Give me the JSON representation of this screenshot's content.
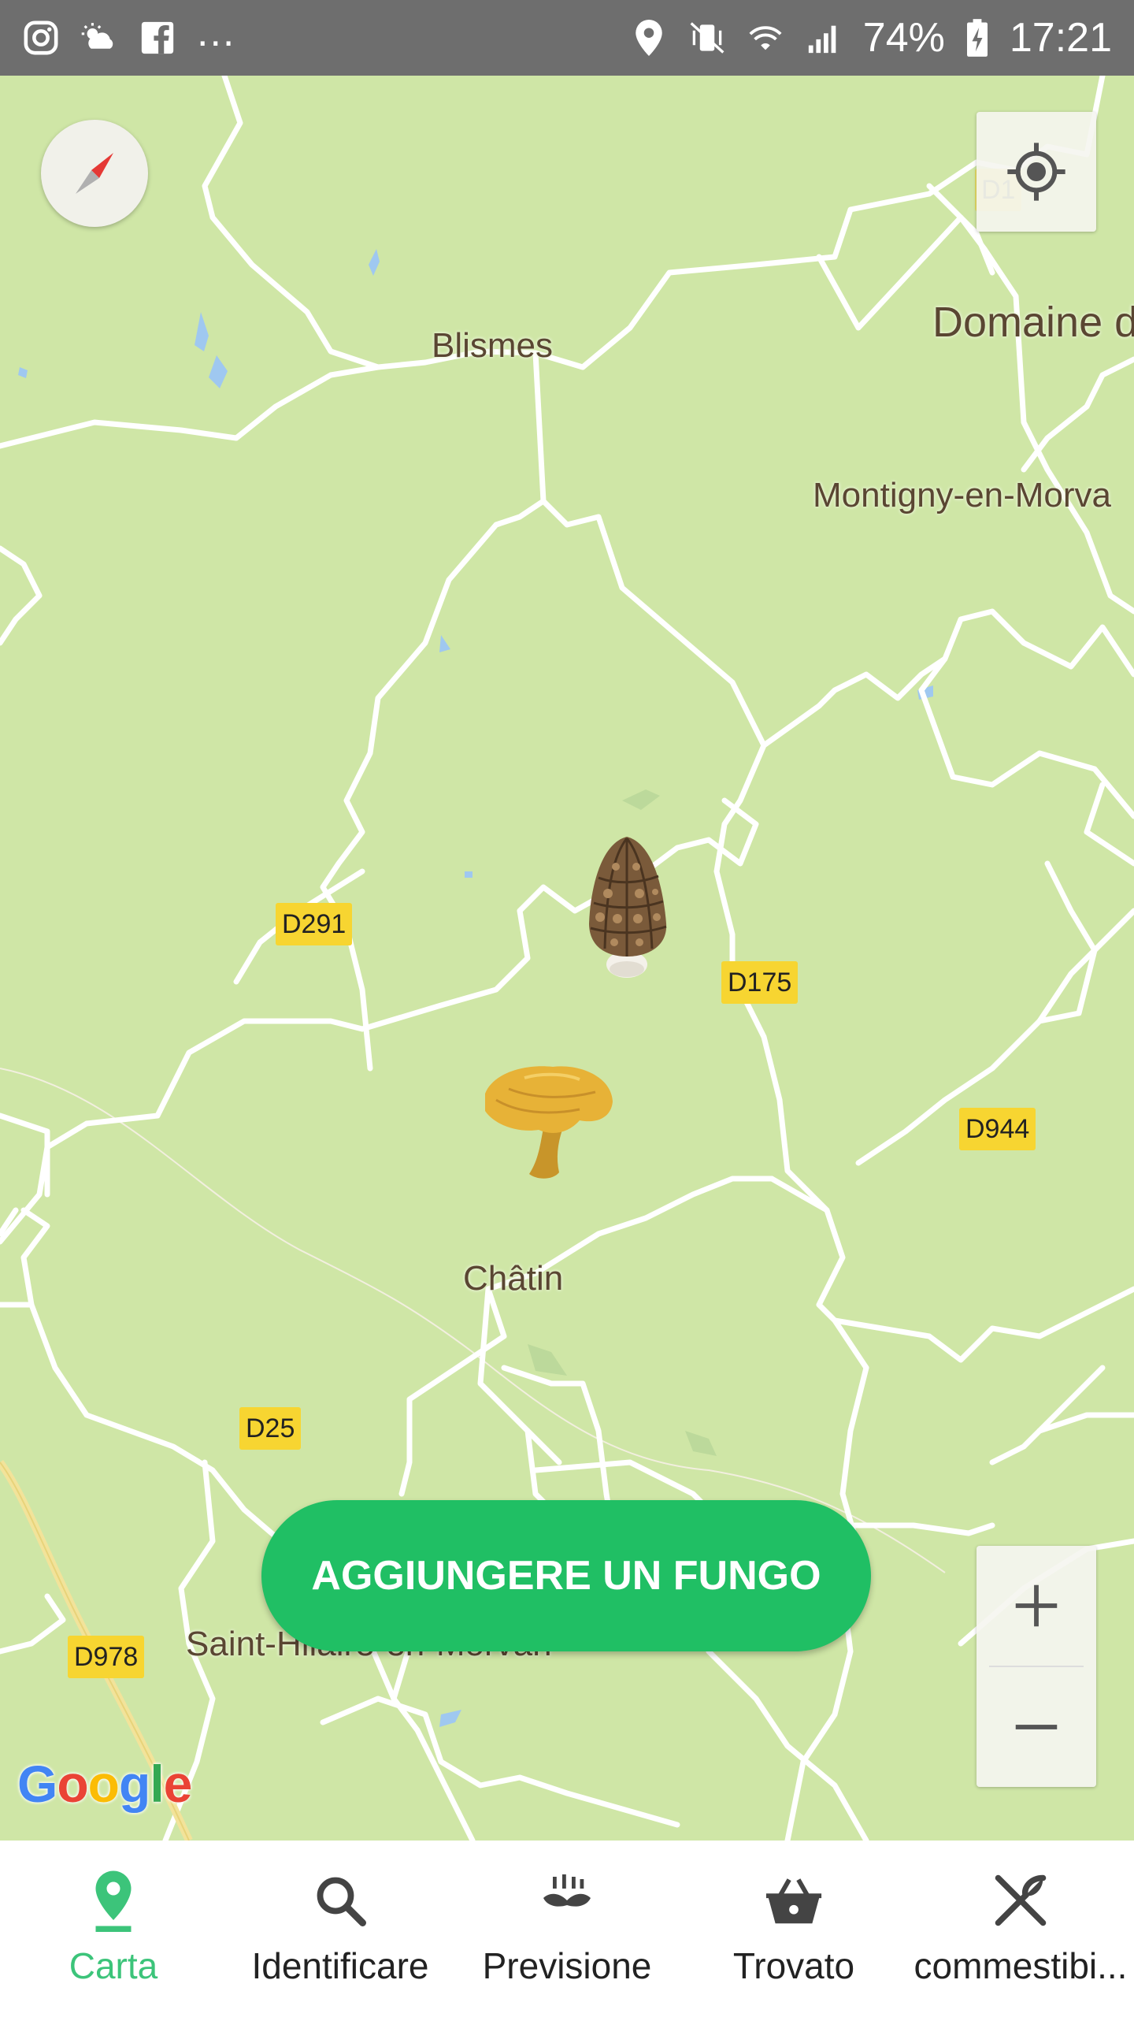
{
  "status_bar": {
    "battery": "74%",
    "time": "17:21",
    "more": "..."
  },
  "map": {
    "places": [
      {
        "name": "Blismes"
      },
      {
        "name": "Domaine d"
      },
      {
        "name": "Montigny-en-Morva"
      },
      {
        "name": "Châtin"
      },
      {
        "name": "Saint-Hilaire-en-Morvan"
      }
    ],
    "roads": [
      "D291",
      "D175",
      "D944",
      "D25",
      "D978",
      "D1"
    ],
    "markers": [
      {
        "species": "morel"
      },
      {
        "species": "chanterelle"
      }
    ],
    "controls": {
      "zoom_in": "+",
      "zoom_out": "−"
    },
    "attribution": "Google"
  },
  "actions": {
    "add_mushroom": "AGGIUNGERE UN FUNGO"
  },
  "nav": {
    "items": [
      {
        "label": "Carta",
        "icon": "map-pin-icon",
        "active": true
      },
      {
        "label": "Identificare",
        "icon": "search-icon"
      },
      {
        "label": "Previsione",
        "icon": "sprout-icon"
      },
      {
        "label": "Trovato",
        "icon": "basket-icon"
      },
      {
        "label": "commestibi...",
        "icon": "fork-knife-icon"
      }
    ]
  },
  "colors": {
    "accent": "#20bf64",
    "nav_active": "#3cc47a",
    "map_land": "#cfe6a6",
    "road_shield": "#f7d531"
  }
}
